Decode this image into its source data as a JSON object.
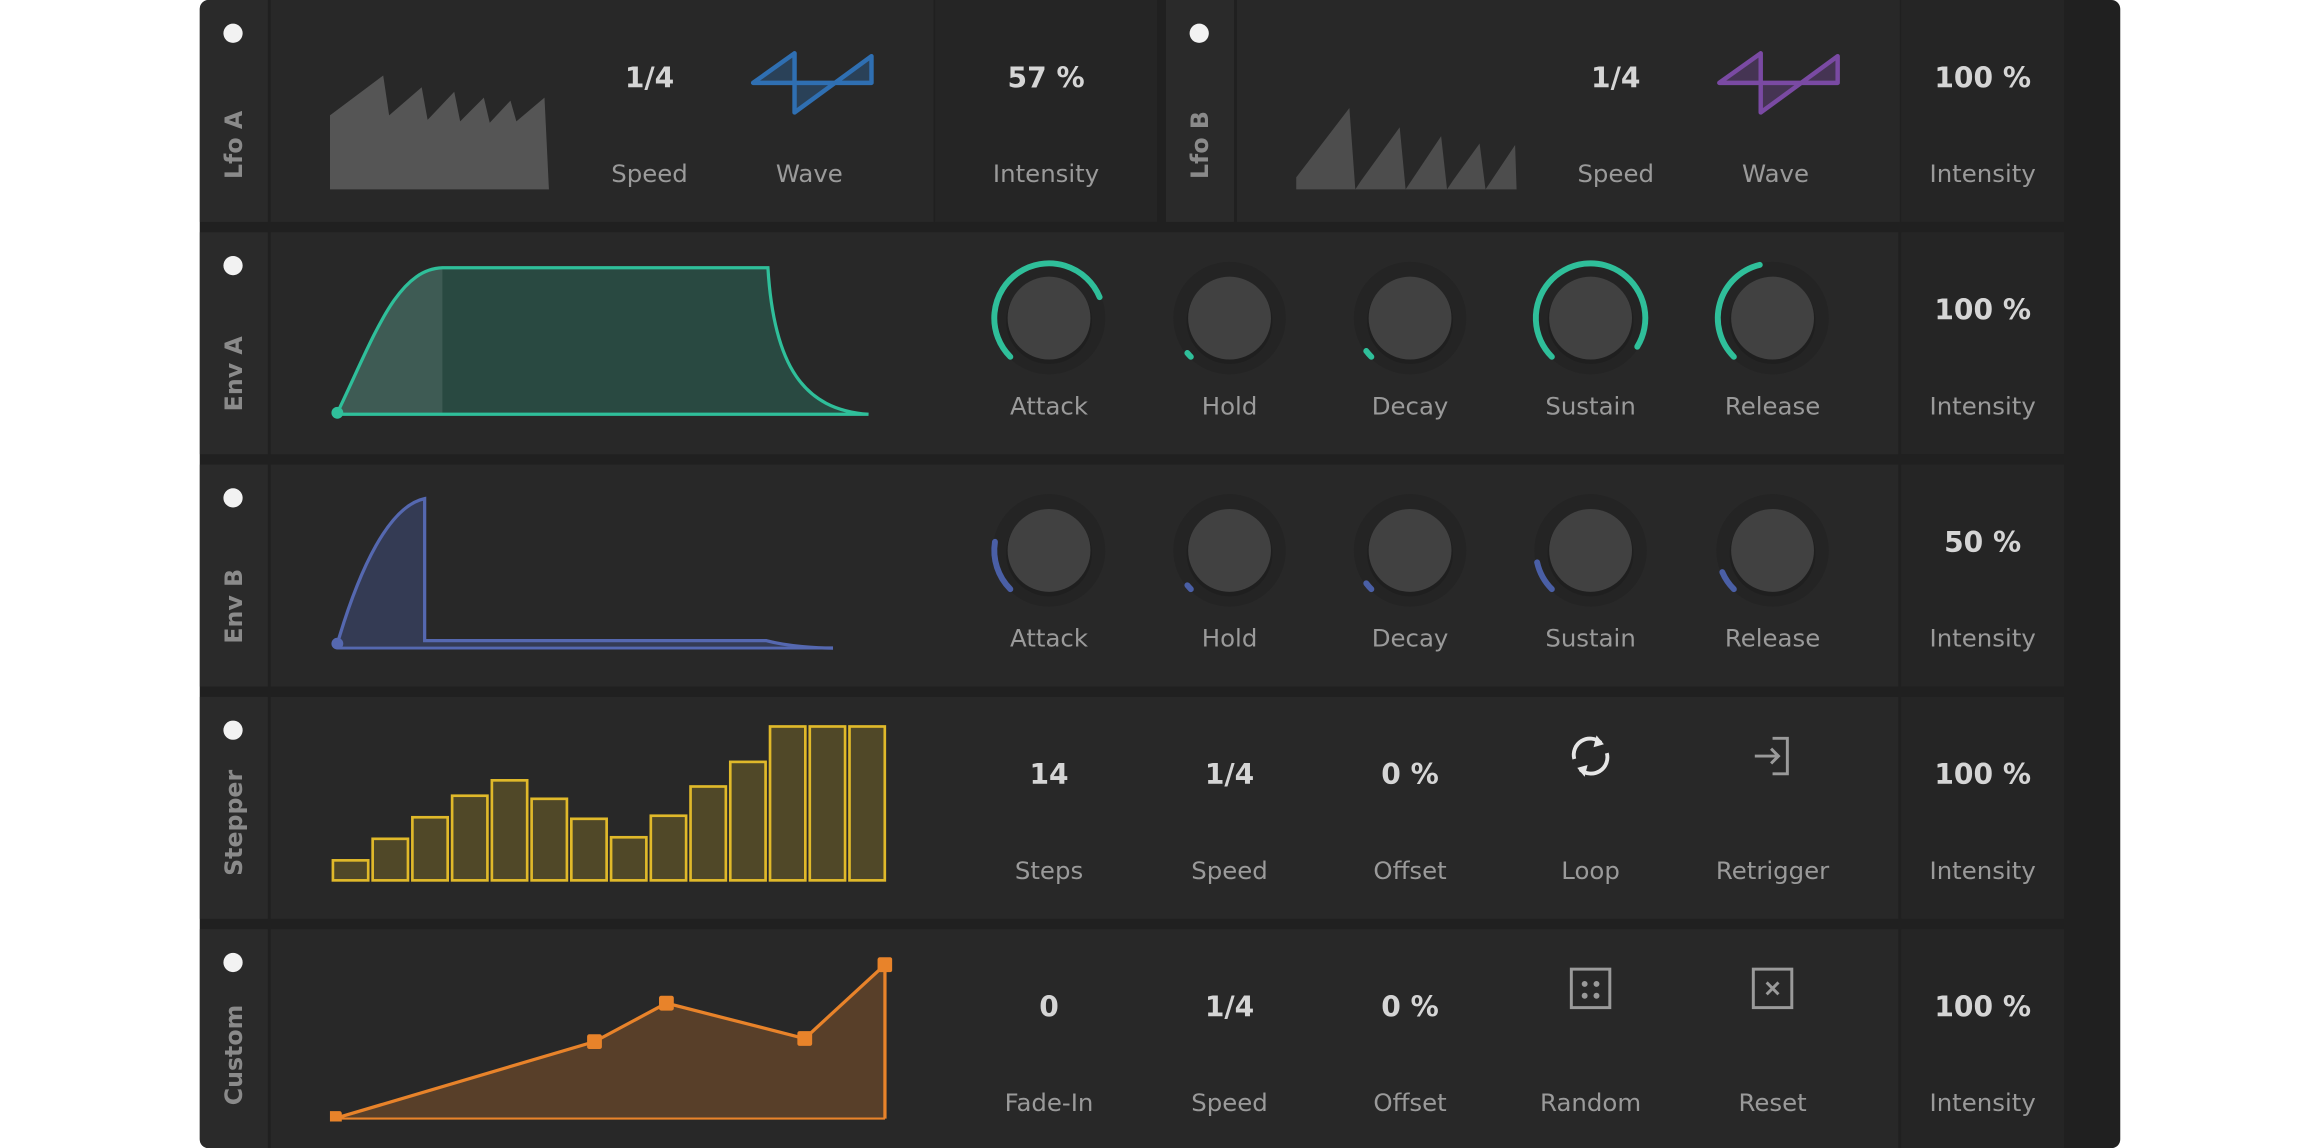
{
  "lfo_a": {
    "title": "Lfo A",
    "speed_value": "1/4",
    "speed_label": "Speed",
    "wave_label": "Wave",
    "intensity_value": "57 %",
    "intensity_label": "Intensity",
    "wave_color": "#2f6fb2"
  },
  "lfo_b": {
    "title": "Lfo B",
    "speed_value": "1/4",
    "speed_label": "Speed",
    "wave_label": "Wave",
    "intensity_value": "100 %",
    "intensity_label": "Intensity",
    "wave_color": "#7a4aa3"
  },
  "env_a": {
    "title": "Env A",
    "color": "#2fbf9a",
    "knobs": [
      {
        "label": "Attack",
        "level": 0.75
      },
      {
        "label": "Hold",
        "level": 0.02
      },
      {
        "label": "Decay",
        "level": 0.03
      },
      {
        "label": "Sustain",
        "level": 0.95
      },
      {
        "label": "Release",
        "level": 0.45
      }
    ],
    "intensity_value": "100 %",
    "intensity_label": "Intensity"
  },
  "env_b": {
    "title": "Env B",
    "color": "#4a5fa6",
    "knobs": [
      {
        "label": "Attack",
        "level": 0.2
      },
      {
        "label": "Hold",
        "level": 0.02
      },
      {
        "label": "Decay",
        "level": 0.03
      },
      {
        "label": "Sustain",
        "level": 0.12
      },
      {
        "label": "Release",
        "level": 0.08
      }
    ],
    "intensity_value": "50 %",
    "intensity_label": "Intensity"
  },
  "stepper": {
    "title": "Stepper",
    "color": "#e0b92a",
    "steps": [
      0.13,
      0.27,
      0.41,
      0.55,
      0.65,
      0.53,
      0.4,
      0.28,
      0.42,
      0.61,
      0.77,
      1.0,
      1.0,
      1.0
    ],
    "steps_value": "14",
    "steps_label": "Steps",
    "speed_value": "1/4",
    "speed_label": "Speed",
    "offset_value": "0 %",
    "offset_label": "Offset",
    "loop_label": "Loop",
    "loop_icon": "loop-icon",
    "retrigger_label": "Retrigger",
    "retrigger_icon": "retrigger-icon",
    "intensity_value": "100 %",
    "intensity_label": "Intensity"
  },
  "custom": {
    "title": "Custom",
    "color": "#e8832a",
    "points": [
      [
        0,
        0
      ],
      [
        0.47,
        0.5
      ],
      [
        0.6,
        0.75
      ],
      [
        0.85,
        0.52
      ],
      [
        0.995,
        1.0
      ]
    ],
    "fadein_value": "0",
    "fadein_label": "Fade-In",
    "speed_value": "1/4",
    "speed_label": "Speed",
    "offset_value": "0 %",
    "offset_label": "Offset",
    "random_label": "Random",
    "random_icon": "dice-icon",
    "reset_label": "Reset",
    "reset_icon": "reset-x-icon",
    "intensity_value": "100 %",
    "intensity_label": "Intensity"
  }
}
